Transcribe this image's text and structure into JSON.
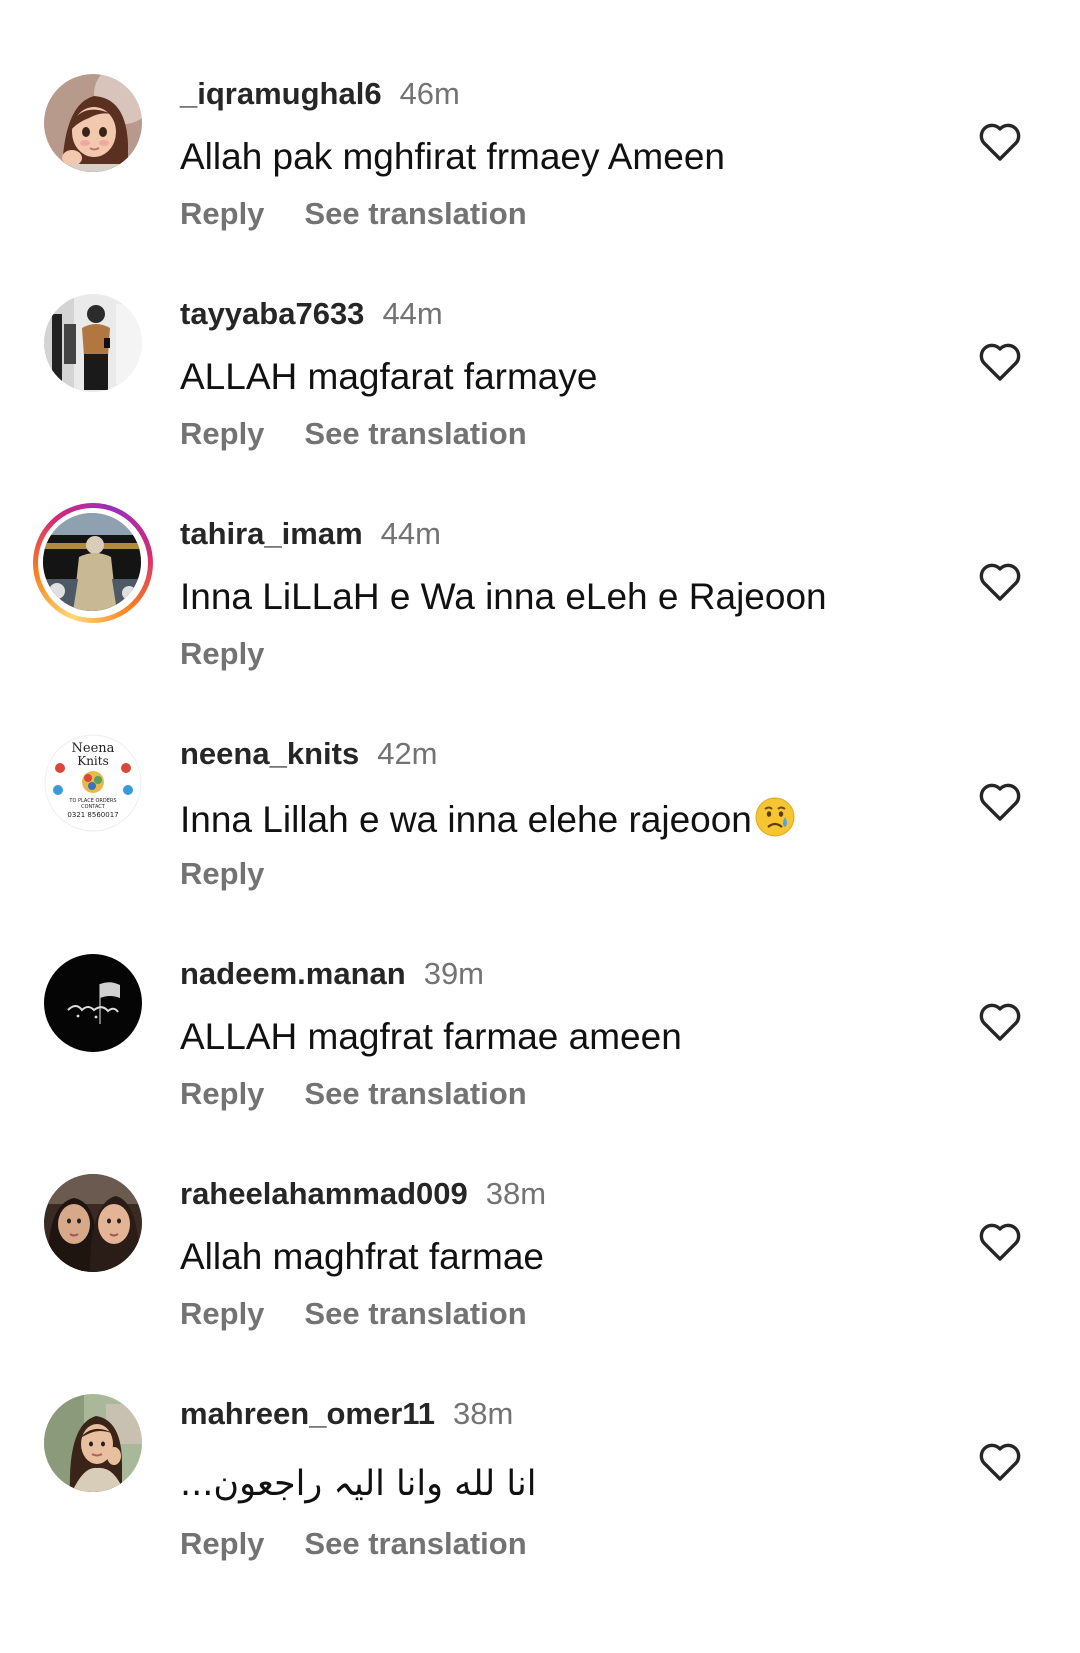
{
  "labels": {
    "reply": "Reply",
    "see_translation": "See translation"
  },
  "comments": [
    {
      "username": "_iqramughal6",
      "time": "46m",
      "text": "Allah pak mghfirat frmaey Ameen",
      "has_translation": true,
      "avatar_icon": "cartoon-girl-avatar"
    },
    {
      "username": "tayyaba7633",
      "time": "44m",
      "text": "ALLAH magfarat farmaye",
      "has_translation": true,
      "avatar_icon": "mirror-selfie-avatar"
    },
    {
      "username": "tahira_imam",
      "time": "44m",
      "text": "Inna LiLLaH e Wa inna eLeh e Rajeoon",
      "has_translation": false,
      "avatar_icon": "kaaba-photo-avatar",
      "has_story_ring": true
    },
    {
      "username": "neena_knits",
      "time": "42m",
      "text": "Inna Lillah e wa inna elehe rajeoon",
      "emoji": "crying-face-emoji",
      "has_translation": false,
      "avatar_icon": "neena-knits-logo-avatar",
      "avatar_text": [
        "Neena",
        "Knits",
        "TO PLACE ORDERS",
        "CONTACT",
        "0321 8560017"
      ]
    },
    {
      "username": "nadeem.manan",
      "time": "39m",
      "text": "ALLAH magfrat farmae ameen",
      "has_translation": true,
      "avatar_icon": "black-flag-calligraphy-avatar"
    },
    {
      "username": "raheelahammad009",
      "time": "38m",
      "text": "Allah maghfrat farmae",
      "has_translation": true,
      "avatar_icon": "two-women-selfie-avatar"
    },
    {
      "username": "mahreen_omer11",
      "time": "38m",
      "text": "انا لله وانا الیہ راجعون...",
      "rtl": true,
      "has_translation": true,
      "avatar_icon": "woman-portrait-avatar"
    }
  ],
  "colors": {
    "username": "#262626",
    "secondary": "#737373",
    "text": "#111111",
    "background": "#ffffff"
  }
}
